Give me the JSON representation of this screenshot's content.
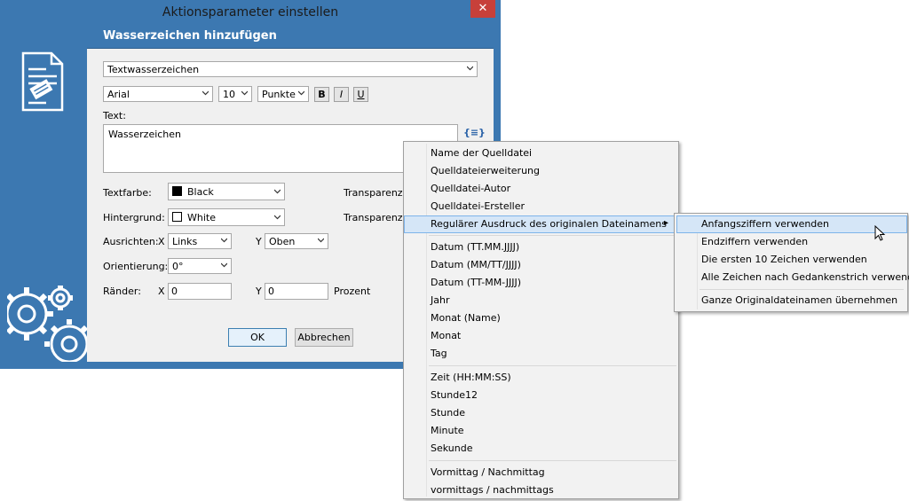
{
  "window": {
    "title": "Aktionsparameter einstellen",
    "close_glyph": "✕"
  },
  "dialog": {
    "header": "Wasserzeichen hinzufügen",
    "type_select": "Textwasserzeichen",
    "font_family": "Arial",
    "font_size": "10",
    "font_unit": "Punkte",
    "bold": "B",
    "italic": "I",
    "underline": "U",
    "text_label": "Text:",
    "text_value": "Wasserzeichen",
    "variables_glyph": "{≡}",
    "textcolor_label": "Textfarbe:",
    "textcolor_value": "Black",
    "background_label": "Hintergrund:",
    "background_value": "White",
    "transparency_label": "Transparenz:",
    "align_label": "Ausrichten:",
    "align_x_label": "X",
    "align_x_value": "Links",
    "align_y_label": "Y",
    "align_y_value": "Oben",
    "orientation_label": "Orientierung:",
    "orientation_value": "0°",
    "margins_label": "Ränder:",
    "margin_x_label": "X",
    "margin_x_value": "0",
    "margin_y_label": "Y",
    "margin_y_value": "0",
    "margin_unit": "Prozent",
    "ok": "OK",
    "cancel": "Abbrechen"
  },
  "context_menu": {
    "items": [
      "Name der Quelldatei",
      "Quelldateierweiterung",
      "Quelldatei-Autor",
      "Quelldatei-Ersteller",
      "Regulärer Ausdruck des originalen Dateinamens",
      "Datum (TT.MM.JJJJ)",
      "Datum (MM/TT/JJJJ)",
      "Datum (TT-MM-JJJJ)",
      "Jahr",
      "Monat (Name)",
      "Monat",
      "Tag",
      "Zeit (HH:MM:SS)",
      "Stunde12",
      "Stunde",
      "Minute",
      "Sekunde",
      "Vormittag / Nachmittag",
      "vormittags / nachmittags"
    ],
    "submenu_arrow": "▸"
  },
  "submenu": {
    "items": [
      "Anfangsziffern verwenden",
      "Endziffern verwenden",
      "Die ersten 10 Zeichen verwenden",
      "Alle Zeichen nach Gedankenstrich verwenden",
      "Ganze Originaldateinamen übernehmen"
    ]
  },
  "colors": {
    "accent": "#3c78b1",
    "close": "#c7403a",
    "highlight": "#d5e6f7"
  }
}
